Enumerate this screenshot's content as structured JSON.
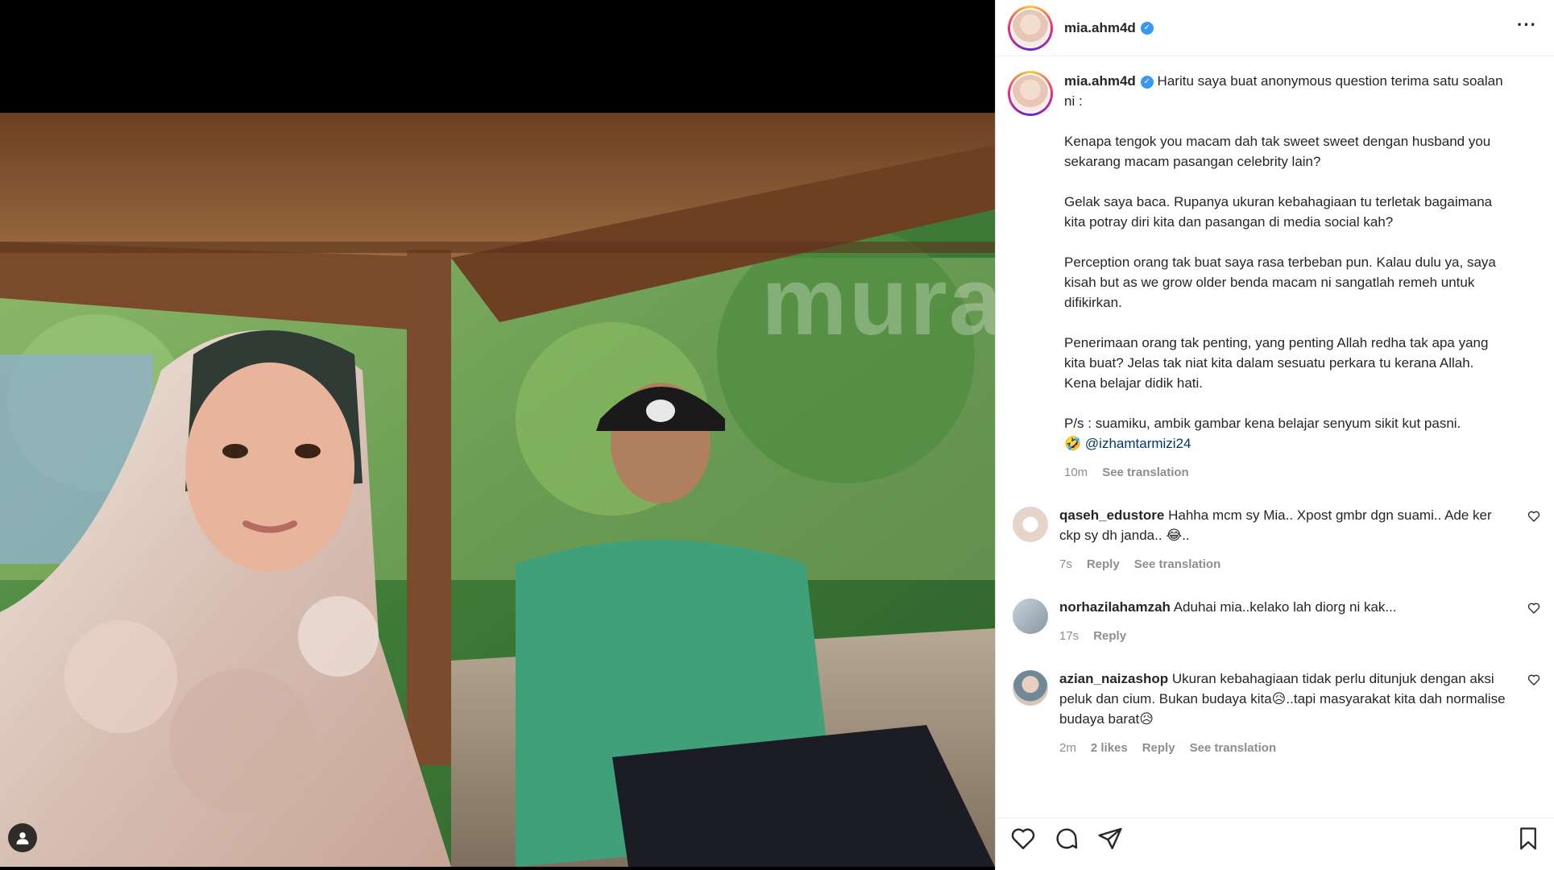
{
  "post": {
    "username": "mia.ahm4d",
    "verified": true,
    "more_icon": "more-horizontal-icon",
    "watermark": "murai"
  },
  "caption": {
    "username": "mia.ahm4d",
    "text": "Haritu saya buat anonymous question terima satu soalan ni :\n\nKenapa tengok you macam dah tak sweet sweet dengan husband you sekarang macam pasangan celebrity lain?\n\nGelak saya baca. Rupanya ukuran kebahagiaan tu terletak bagaimana kita potray diri kita dan pasangan di media social kah?\n\nPerception orang tak buat saya rasa terbeban pun. Kalau dulu ya, saya kisah but as we grow older benda macam ni sangatlah remeh untuk difikirkan.\n\nPenerimaan orang tak penting, yang penting Allah redha tak apa yang kita buat? Jelas tak niat kita dalam sesuatu perkara tu kerana Allah. Kena belajar didik hati.\n\nP/s : suamiku, ambik gambar kena belajar senyum sikit kut pasni.",
    "emoji": "🤣",
    "mention": "@izhamtarmizi24",
    "time": "10m",
    "see_translation": "See translation"
  },
  "comments": [
    {
      "username": "qaseh_edustore",
      "text": "Hahha mcm sy Mia.. Xpost gmbr dgn suami.. Ade ker ckp sy dh janda.. ",
      "emoji": "😂",
      "tail": "..",
      "time": "7s",
      "reply": "Reply",
      "see_translation": "See translation",
      "avatar_color": "#e6d3c9"
    },
    {
      "username": "norhazilahamzah",
      "text": "Aduhai mia..kelako lah diorg ni kak...",
      "time": "17s",
      "reply": "Reply",
      "avatar_color": "#a9b6bf"
    },
    {
      "username": "azian_naizashop",
      "text1": "Ukuran kebahagiaan tidak perlu ditunjuk dengan aksi peluk dan cium. Bukan budaya kita",
      "emoji1": "😥",
      "text2": "..tapi masyarakat kita dah normalise budaya barat",
      "emoji2": "😥",
      "time": "2m",
      "likes": "2 likes",
      "reply": "Reply",
      "see_translation": "See translation",
      "avatar_color": "#b9a89a"
    }
  ],
  "action_icons": [
    "heart-icon",
    "comment-icon",
    "share-icon",
    "bookmark-icon"
  ],
  "colors": {
    "verified": "#3897f0",
    "mention": "#00376b",
    "muted": "#8e8e8e"
  }
}
